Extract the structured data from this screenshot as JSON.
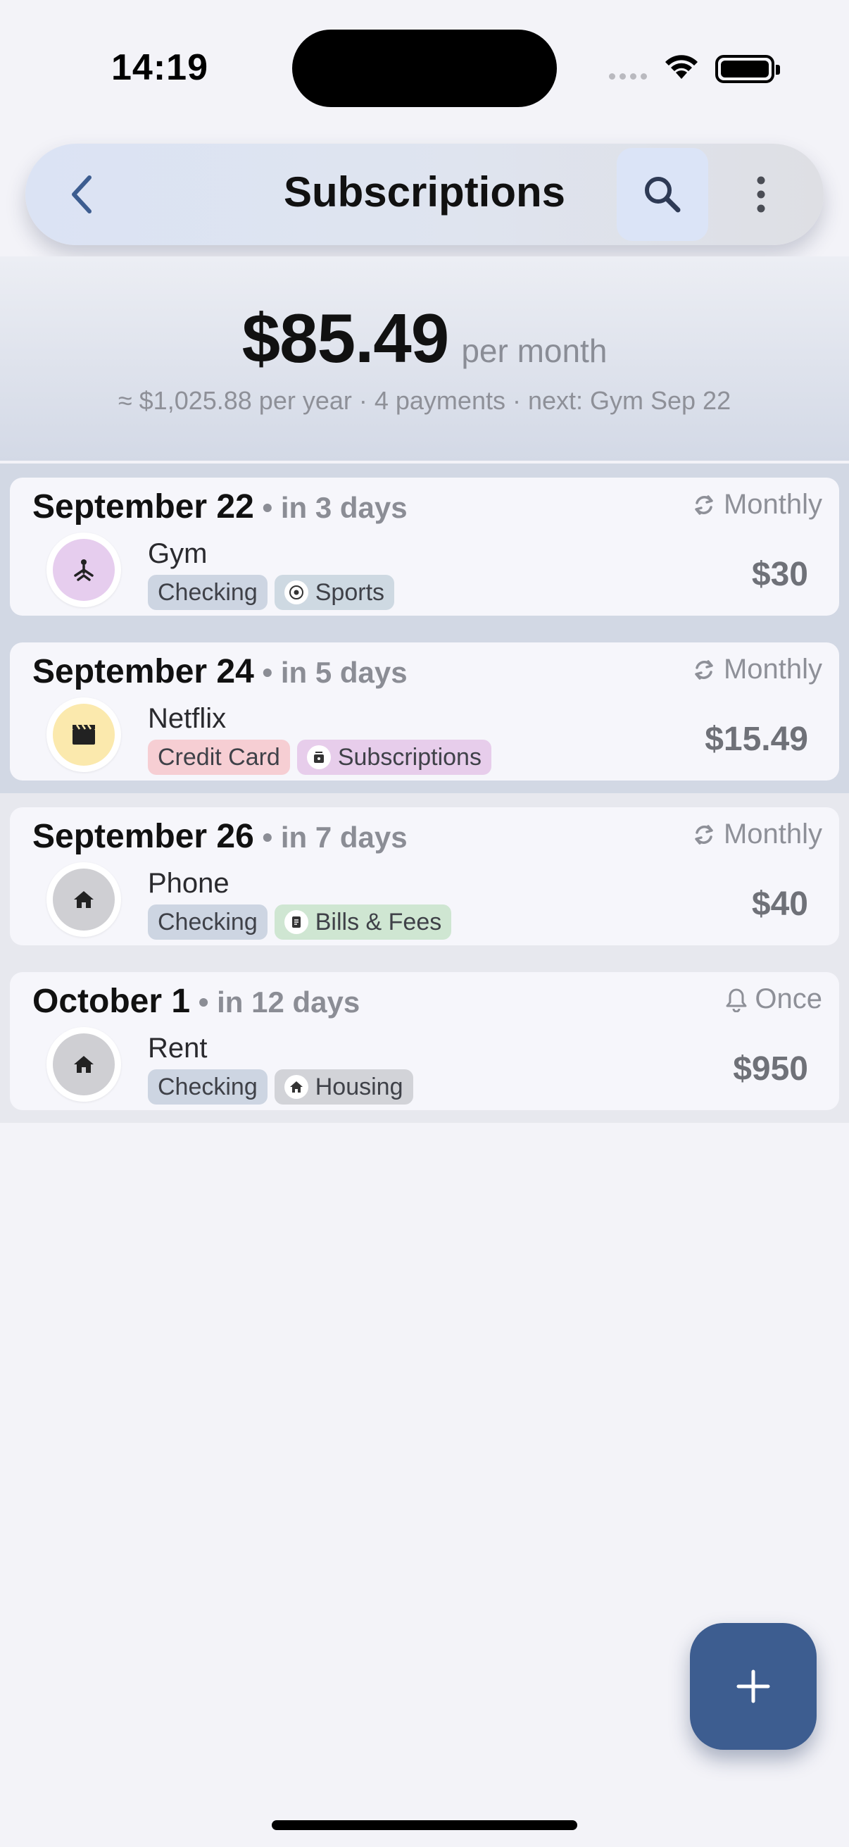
{
  "status_bar": {
    "time": "14:19"
  },
  "nav": {
    "title": "Subscriptions"
  },
  "summary": {
    "amount": "$85.49",
    "period": "per month",
    "details": "≈ $1,025.88 per year · 4 payments · next: Gym Sep 22"
  },
  "payments": [
    {
      "date": "September 22",
      "relative": "in 3 days",
      "frequency": "Monthly",
      "frequency_icon": "repeat-icon",
      "name": "Gym",
      "icon": "sports-icon",
      "icon_color": "#e6cdee",
      "account": "Checking",
      "category": "Sports",
      "category_icon": "soccer-ball-icon",
      "amount": "$30"
    },
    {
      "date": "September 24",
      "relative": "in 5 days",
      "frequency": "Monthly",
      "frequency_icon": "repeat-icon",
      "name": "Netflix",
      "icon": "clapperboard-icon",
      "icon_color": "#fbe9ad",
      "account": "Credit Card",
      "category": "Subscriptions",
      "category_icon": "subscription-box-icon",
      "amount": "$15.49"
    },
    {
      "date": "September 26",
      "relative": "in 7 days",
      "frequency": "Monthly",
      "frequency_icon": "repeat-icon",
      "name": "Phone",
      "icon": "home-icon",
      "icon_color": "#cfcfd3",
      "account": "Checking",
      "category": "Bills & Fees",
      "category_icon": "bill-icon",
      "amount": "$40"
    },
    {
      "date": "October 1",
      "relative": "in 12 days",
      "frequency": "Once",
      "frequency_icon": "bell-icon",
      "name": "Rent",
      "icon": "home-icon",
      "icon_color": "#cfcfd3",
      "account": "Checking",
      "category": "Housing",
      "category_icon": "house-icon",
      "amount": "$950"
    }
  ],
  "colors": {
    "accent": "#3d5d90",
    "fab": "#3d5d90"
  }
}
